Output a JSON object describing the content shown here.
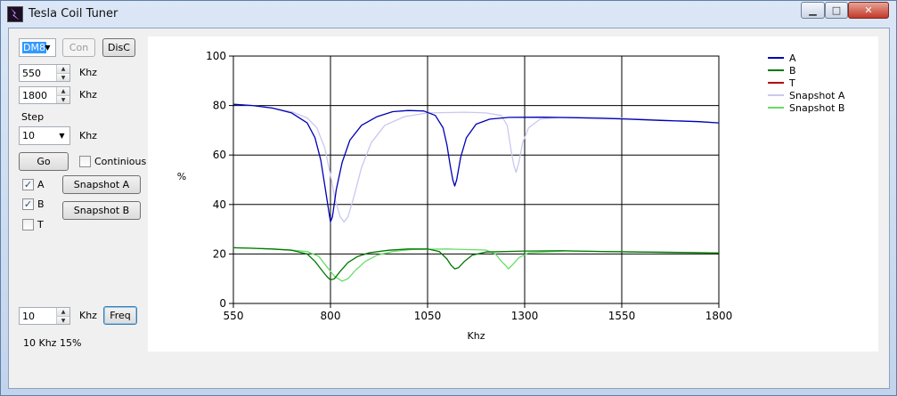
{
  "window": {
    "title": "Tesla Coil Tuner",
    "min_icon": "minimize-icon",
    "max_icon": "maximize-icon",
    "close_icon": "close-icon",
    "min_glyph": "▁",
    "max_glyph": "□",
    "close_glyph": "✕"
  },
  "controls": {
    "device_combo": {
      "value": "DM8"
    },
    "connect_button": "Con",
    "disconnect_button": "DisC",
    "start_freq": {
      "value": "550",
      "unit": "Khz"
    },
    "end_freq": {
      "value": "1800",
      "unit": "Khz"
    },
    "step_label": "Step",
    "step_combo": {
      "value": "10",
      "unit": "Khz"
    },
    "go_button": "Go",
    "continuous": {
      "label": "Continious",
      "checked": false
    },
    "channel_a": {
      "label": "A",
      "checked": true
    },
    "channel_b": {
      "label": "B",
      "checked": true
    },
    "channel_t": {
      "label": "T",
      "checked": false
    },
    "snapshot_a_button": "Snapshot A",
    "snapshot_b_button": "Snapshot B",
    "freq_input": {
      "value": "10",
      "unit": "Khz"
    },
    "freq_button": "Freq",
    "status": "10 Khz 15%"
  },
  "chart_data": {
    "type": "line",
    "title": "",
    "xlabel": "Khz",
    "ylabel": "%",
    "xlim": [
      550,
      1800
    ],
    "ylim": [
      0,
      100
    ],
    "x_ticks": [
      550,
      800,
      1050,
      1300,
      1550,
      1800
    ],
    "y_ticks": [
      0,
      20,
      40,
      60,
      80,
      100
    ],
    "grid": true,
    "legend_position": "top-right",
    "series": [
      {
        "name": "A",
        "color": "#0000b4",
        "points": [
          [
            550,
            80.5
          ],
          [
            600,
            80
          ],
          [
            650,
            79
          ],
          [
            700,
            77
          ],
          [
            740,
            73
          ],
          [
            760,
            67
          ],
          [
            775,
            58
          ],
          [
            785,
            48
          ],
          [
            795,
            38
          ],
          [
            800,
            33
          ],
          [
            805,
            35
          ],
          [
            815,
            46
          ],
          [
            830,
            57
          ],
          [
            850,
            66
          ],
          [
            880,
            72
          ],
          [
            920,
            75.5
          ],
          [
            960,
            77.5
          ],
          [
            1000,
            78
          ],
          [
            1040,
            77.8
          ],
          [
            1070,
            76
          ],
          [
            1090,
            71
          ],
          [
            1100,
            64
          ],
          [
            1108,
            56
          ],
          [
            1115,
            50
          ],
          [
            1120,
            47.5
          ],
          [
            1125,
            50
          ],
          [
            1135,
            59
          ],
          [
            1150,
            67
          ],
          [
            1175,
            72.5
          ],
          [
            1210,
            74.5
          ],
          [
            1260,
            75.2
          ],
          [
            1350,
            75.3
          ],
          [
            1450,
            75
          ],
          [
            1550,
            74.6
          ],
          [
            1650,
            74
          ],
          [
            1750,
            73.5
          ],
          [
            1800,
            73
          ]
        ]
      },
      {
        "name": "B",
        "color": "#007800",
        "points": [
          [
            550,
            22.5
          ],
          [
            600,
            22.3
          ],
          [
            650,
            22
          ],
          [
            700,
            21.5
          ],
          [
            740,
            20
          ],
          [
            760,
            17
          ],
          [
            775,
            14
          ],
          [
            790,
            11
          ],
          [
            800,
            9.5
          ],
          [
            810,
            10
          ],
          [
            825,
            13
          ],
          [
            845,
            16.5
          ],
          [
            870,
            19
          ],
          [
            900,
            20.5
          ],
          [
            950,
            21.5
          ],
          [
            1000,
            22
          ],
          [
            1050,
            22
          ],
          [
            1080,
            21
          ],
          [
            1100,
            18
          ],
          [
            1110,
            15.5
          ],
          [
            1120,
            14
          ],
          [
            1130,
            14.5
          ],
          [
            1145,
            17
          ],
          [
            1165,
            19.5
          ],
          [
            1200,
            20.8
          ],
          [
            1300,
            21.2
          ],
          [
            1400,
            21.3
          ],
          [
            1500,
            21
          ],
          [
            1600,
            20.8
          ],
          [
            1700,
            20.6
          ],
          [
            1800,
            20.4
          ]
        ]
      },
      {
        "name": "T",
        "color": "#b40000",
        "points": []
      },
      {
        "name": "Snapshot A",
        "color": "#c8c8f0",
        "points": [
          [
            550,
            80.5
          ],
          [
            600,
            80
          ],
          [
            650,
            79
          ],
          [
            700,
            77.5
          ],
          [
            740,
            75
          ],
          [
            765,
            71
          ],
          [
            785,
            63
          ],
          [
            800,
            52
          ],
          [
            812,
            42
          ],
          [
            825,
            35
          ],
          [
            835,
            33
          ],
          [
            845,
            35
          ],
          [
            860,
            43
          ],
          [
            880,
            55
          ],
          [
            905,
            65
          ],
          [
            940,
            72
          ],
          [
            990,
            75.5
          ],
          [
            1050,
            77
          ],
          [
            1150,
            77.3
          ],
          [
            1200,
            77
          ],
          [
            1240,
            76
          ],
          [
            1255,
            72
          ],
          [
            1265,
            62
          ],
          [
            1272,
            56
          ],
          [
            1278,
            53
          ],
          [
            1285,
            57
          ],
          [
            1295,
            65
          ],
          [
            1310,
            71
          ],
          [
            1340,
            74.5
          ],
          [
            1400,
            75.3
          ],
          [
            1500,
            75.2
          ],
          [
            1600,
            74.6
          ],
          [
            1700,
            73.8
          ],
          [
            1800,
            73
          ]
        ]
      },
      {
        "name": "Snapshot B",
        "color": "#66dd66",
        "points": [
          [
            550,
            22.5
          ],
          [
            600,
            22.3
          ],
          [
            650,
            22
          ],
          [
            700,
            21.6
          ],
          [
            740,
            21
          ],
          [
            770,
            19
          ],
          [
            790,
            15
          ],
          [
            810,
            11
          ],
          [
            830,
            9
          ],
          [
            845,
            10
          ],
          [
            865,
            13.5
          ],
          [
            890,
            17
          ],
          [
            920,
            19.5
          ],
          [
            960,
            21
          ],
          [
            1010,
            21.8
          ],
          [
            1100,
            22
          ],
          [
            1200,
            21.6
          ],
          [
            1225,
            20
          ],
          [
            1240,
            17
          ],
          [
            1250,
            15.5
          ],
          [
            1258,
            14
          ],
          [
            1268,
            15.5
          ],
          [
            1285,
            18.5
          ],
          [
            1310,
            20.5
          ],
          [
            1400,
            21.2
          ],
          [
            1500,
            21
          ],
          [
            1600,
            20.8
          ],
          [
            1700,
            20.6
          ],
          [
            1800,
            20.4
          ]
        ]
      }
    ]
  }
}
